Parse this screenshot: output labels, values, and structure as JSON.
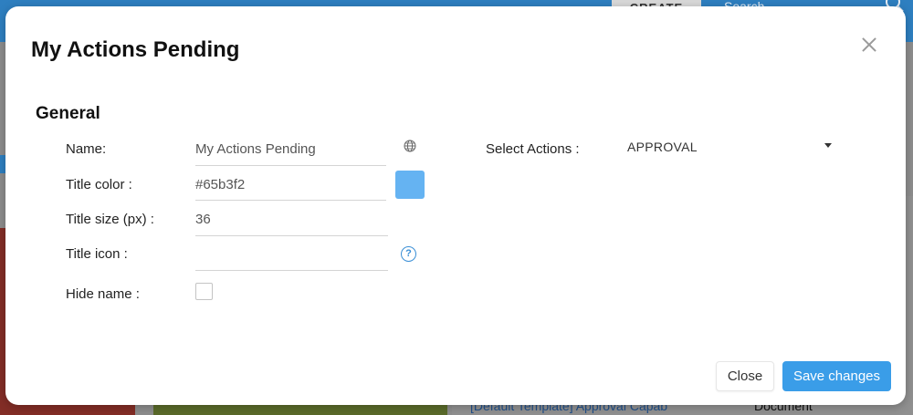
{
  "background": {
    "create_label": "CREATE",
    "search_placeholder": "Search",
    "list_link": "[Default Template] Approval Capab",
    "list_type": "Document"
  },
  "modal": {
    "title": "My Actions Pending",
    "section_title": "General",
    "fields": {
      "name_label": "Name:",
      "name_value": "My Actions Pending",
      "title_color_label": "Title color :",
      "title_color_value": "#65b3f2",
      "title_size_label": "Title size (px) :",
      "title_size_value": "36",
      "title_icon_label": "Title icon :",
      "title_icon_value": "",
      "hide_name_label": "Hide name :",
      "hide_name_checked": false,
      "select_actions_label": "Select Actions :",
      "select_actions_value": "APPROVAL"
    },
    "help_glyph": "?",
    "buttons": {
      "close_label": "Close",
      "save_label": "Save changes"
    }
  },
  "colors": {
    "swatch": "#65b3f2",
    "save_button": "#3a9de8",
    "help_icon": "#3a8fd6"
  },
  "icons": [
    "close-icon",
    "globe-icon",
    "help-icon",
    "chevron-down-icon",
    "search-icon"
  ]
}
